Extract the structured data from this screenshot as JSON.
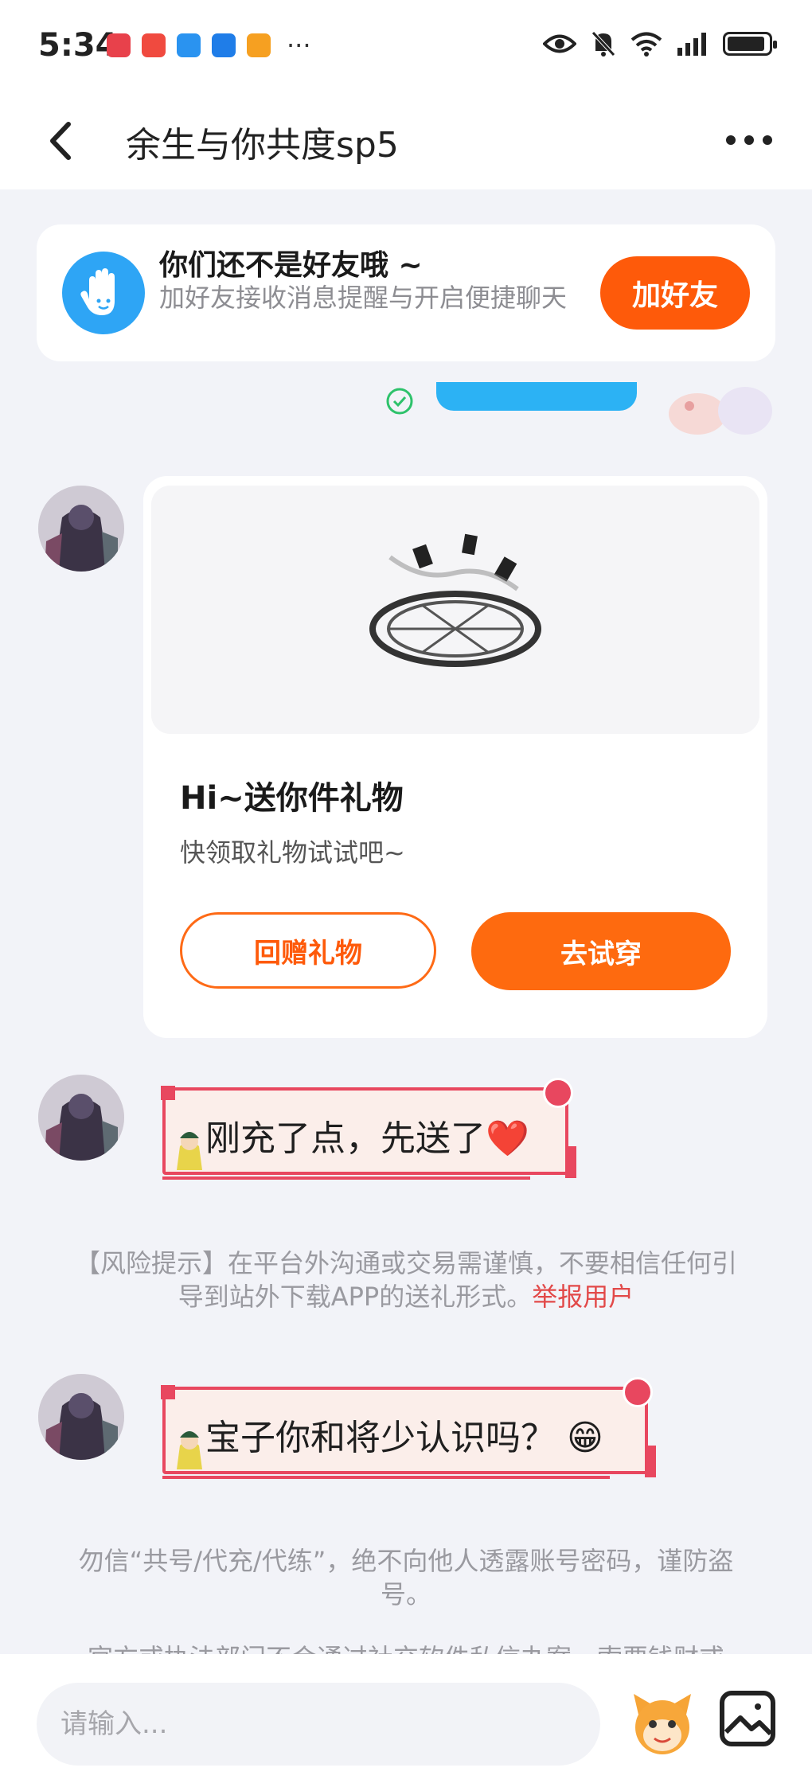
{
  "status_bar": {
    "time": "5:34",
    "app_icons": [
      "shop-icon",
      "book-icon",
      "search-app-icon",
      "weather-icon",
      "video-icon"
    ],
    "more_dots": "···",
    "indicators": [
      "eye-icon",
      "mute-bell-icon",
      "wifi-icon",
      "signal-icon",
      "battery-icon"
    ],
    "battery_level": 0.92
  },
  "header": {
    "title": "余生与你共度sp5"
  },
  "friend_banner": {
    "title": "你们还不是好友哦 ~",
    "subtitle": "加好友接收消息提醒与开启便捷聊天",
    "add_button": "加好友"
  },
  "gift_card": {
    "title": "Hi~送你件礼物",
    "subtitle": "快领取礼物试试吧~",
    "return_button": "回赠礼物",
    "try_button": "去试穿"
  },
  "messages": [
    {
      "text": "刚充了点，先送了",
      "emoji": "❤️"
    },
    {
      "text": "宝子你和将少认识吗？",
      "emoji": "😁"
    }
  ],
  "notices": {
    "risk_text": "【风险提示】在平台外沟通或交易需谨慎，不要相信任何引导到站外下载APP的送礼形式。",
    "report_link": "举报用户",
    "account_warning": "勿信“共号/代充/代练”，绝不向他人透露账号密码，谨防盗号。",
    "cutoff_text": "官方或执法部门不会通过社交软件私信办案，索要钱财或"
  },
  "input_bar": {
    "placeholder": "请输入..."
  },
  "colors": {
    "accent": "#fe5a0a",
    "bubble_border": "#e8475f",
    "bubble_fill": "#fbeeea",
    "link_red": "#e24949",
    "hand_blue": "#2ea5f5"
  }
}
